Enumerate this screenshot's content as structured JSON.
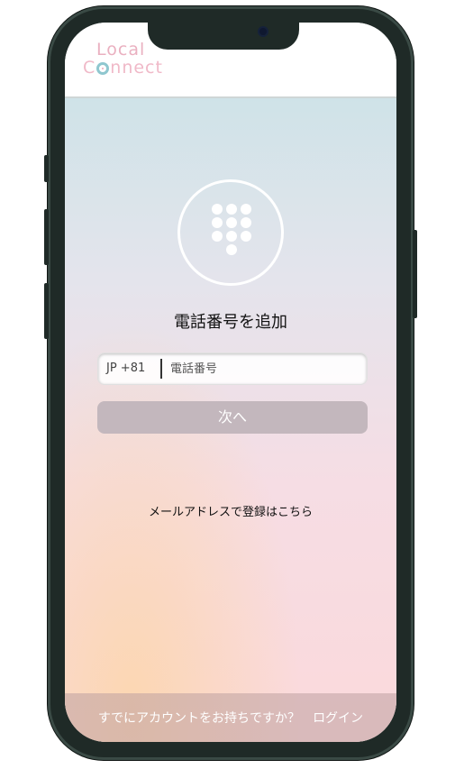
{
  "header": {
    "logo_line1": "Local",
    "logo_line2_prefix": "C",
    "logo_line2_suffix": "nnect"
  },
  "main": {
    "icon": "dialpad-icon",
    "title": "電話番号を追加",
    "phone_input": {
      "country_code": "JP +81",
      "placeholder": "電話番号",
      "value": ""
    },
    "next_button_label": "次へ",
    "email_link_label": "メールアドレスで登録はこちら"
  },
  "footer": {
    "prompt": "すでにアカウントをお持ちですか？",
    "login_label": "ログイン"
  },
  "colors": {
    "logo_pink": "#e9a7b9",
    "logo_teal": "#8fc7cf",
    "next_button_bg": "#c3b7bd",
    "phone_frame": "#1f2a27"
  }
}
